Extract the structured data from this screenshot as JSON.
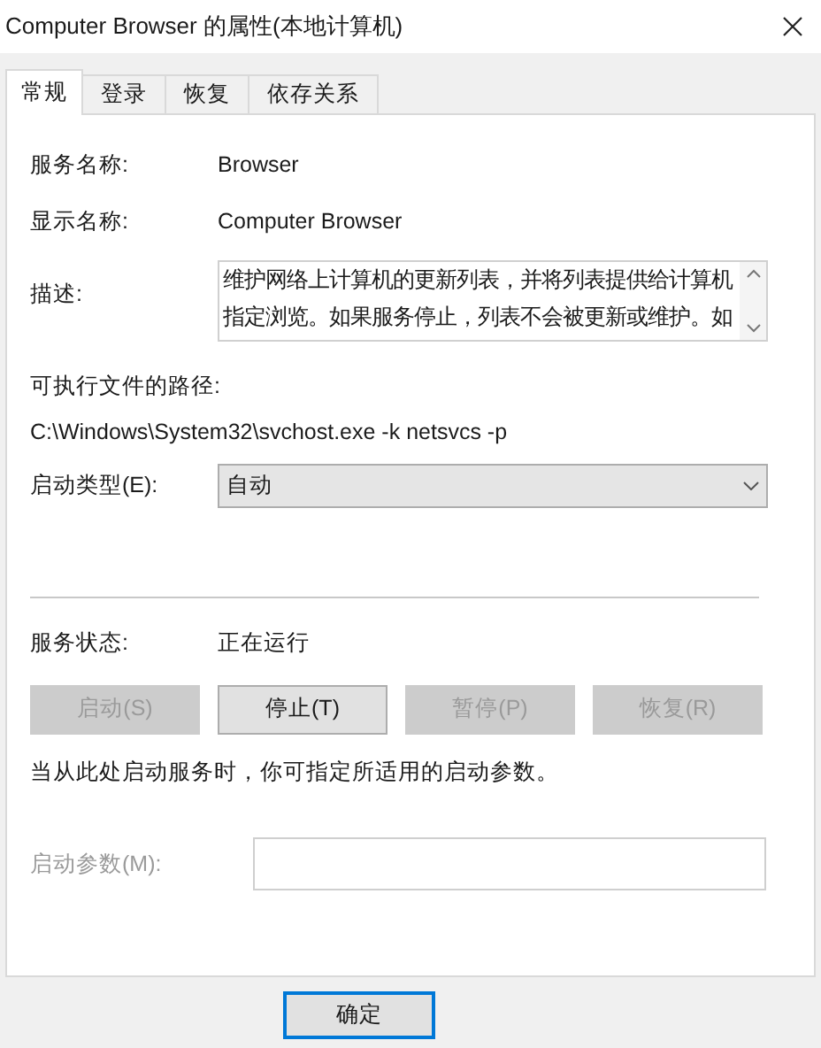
{
  "window": {
    "title": "Computer Browser 的属性(本地计算机)"
  },
  "tabs": [
    {
      "label": "常规",
      "selected": true
    },
    {
      "label": "登录",
      "selected": false
    },
    {
      "label": "恢复",
      "selected": false
    },
    {
      "label": "依存关系",
      "selected": false
    }
  ],
  "service_name": {
    "label": "服务名称:",
    "value": "Browser"
  },
  "display_name": {
    "label": "显示名称:",
    "value": "Computer Browser"
  },
  "description": {
    "label": "描述:",
    "value": "维护网络上计算机的更新列表，并将列表提供给计算机指定浏览。如果服务停止，列表不会被更新或维护。如"
  },
  "path": {
    "label": "可执行文件的路径:",
    "value": "C:\\Windows\\System32\\svchost.exe -k netsvcs -p"
  },
  "startup_type": {
    "label": "启动类型(E):",
    "value": "自动"
  },
  "status": {
    "label": "服务状态:",
    "value": "正在运行"
  },
  "service_buttons": [
    {
      "label": "启动(S)",
      "disabled": true
    },
    {
      "label": "停止(T)",
      "disabled": false
    },
    {
      "label": "暂停(P)",
      "disabled": true
    },
    {
      "label": "恢复(R)",
      "disabled": true
    }
  ],
  "hint": "当从此处启动服务时，你可指定所适用的启动参数。",
  "start_params": {
    "label": "启动参数(M):",
    "disabled": true
  },
  "footer_buttons": [
    {
      "label": "确定",
      "default": true
    }
  ]
}
